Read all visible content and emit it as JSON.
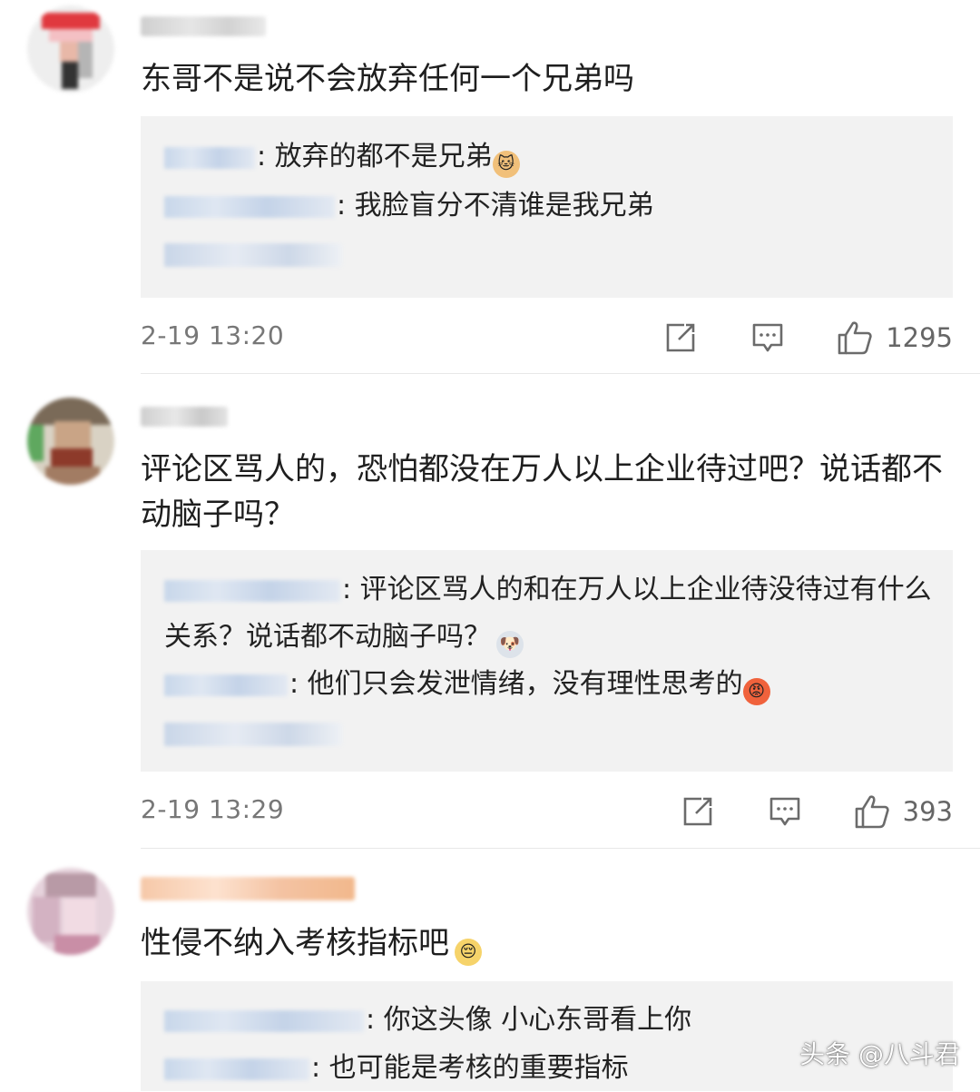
{
  "comments": [
    {
      "text": "东哥不是说不会放弃任何一个兄弟吗",
      "replies": [
        {
          "text": ": 放弃的都不是兄弟"
        },
        {
          "text": ": 我脸盲分不清谁是我兄弟"
        }
      ],
      "timestamp": "2-19 13:20",
      "likes": "1295"
    },
    {
      "text": "评论区骂人的，恐怕都没在万人以上企业待过吧？说话都不动脑子吗？",
      "replies": [
        {
          "text": ": 评论区骂人的和在万人以上企业待没待过有什么关系？说话都不动脑子吗？"
        },
        {
          "text": ": 他们只会发泄情绪，没有理性思考的"
        }
      ],
      "timestamp": "2-19 13:29",
      "likes": "393"
    },
    {
      "text": "性侵不纳入考核指标吧",
      "replies": [
        {
          "text": ": 你这头像 小心东哥看上你"
        },
        {
          "text": ": 也可能是考核的重要指标"
        }
      ]
    }
  ],
  "icons": {
    "share": "share-icon",
    "comment": "comment-icon",
    "like": "thumbs-up-icon",
    "emoji_cat": "cat-emoji-icon",
    "emoji_dog": "husky-emoji-icon",
    "emoji_angry": "angry-emoji-icon",
    "emoji_sad": "sad-emoji-icon"
  },
  "colors": {
    "reply_background": "#f2f2f2",
    "timestamp": "#777777",
    "text": "#1e1e1e"
  },
  "watermark": "头条 @八斗君"
}
